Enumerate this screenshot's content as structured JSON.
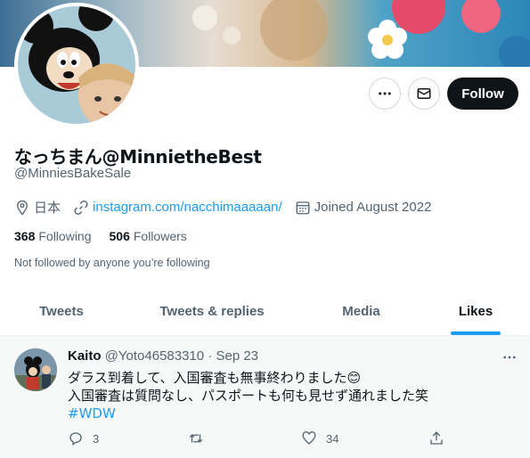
{
  "profile": {
    "display_name": "なっちまん@MinnietheBest",
    "handle": "@MinniesBakeSale",
    "location": "日本",
    "website": "instagram.com/nacchimaaaaan/",
    "joined": "Joined August 2022",
    "following_count": "368",
    "following_label": "Following",
    "followers_count": "506",
    "followers_label": "Followers",
    "not_followed_text": "Not followed by anyone you’re following"
  },
  "actions": {
    "follow_label": "Follow"
  },
  "tabs": [
    {
      "label": "Tweets"
    },
    {
      "label": "Tweets & replies"
    },
    {
      "label": "Media"
    },
    {
      "label": "Likes"
    }
  ],
  "tweet": {
    "author_name": "Kaito",
    "author_handle": "@Yoto46583310",
    "separator": "·",
    "date": "Sep 23",
    "line1": "ダラス到着して、入国審査も無事終わりました😊",
    "line2": "入国審査は質問なし、パスポートも何も見せず通れました笑",
    "hashtag": "#WDW",
    "reply_count": "3",
    "like_count": "34"
  },
  "colors": {
    "accent": "#1d9bf0",
    "text_primary": "#0f1419",
    "text_secondary": "#536471"
  }
}
